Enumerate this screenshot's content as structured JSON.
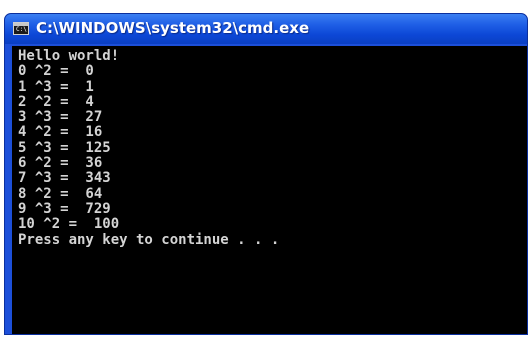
{
  "window": {
    "title": "C:\\WINDOWS\\system32\\cmd.exe",
    "icon": "cmd-icon",
    "icon_glyph": "C:\\"
  },
  "console": {
    "lines": [
      "Hello world!",
      "0 ^2 =  0",
      "1 ^3 =  1",
      "2 ^2 =  4",
      "3 ^3 =  27",
      "4 ^2 =  16",
      "5 ^3 =  125",
      "6 ^2 =  36",
      "7 ^3 =  343",
      "8 ^2 =  64",
      "9 ^3 =  729",
      "10 ^2 =  100",
      "Press any key to continue . . ."
    ]
  },
  "colors": {
    "titlebar": "#0c47d6",
    "console_background": "#000000",
    "console_text": "#d4d4d4"
  }
}
